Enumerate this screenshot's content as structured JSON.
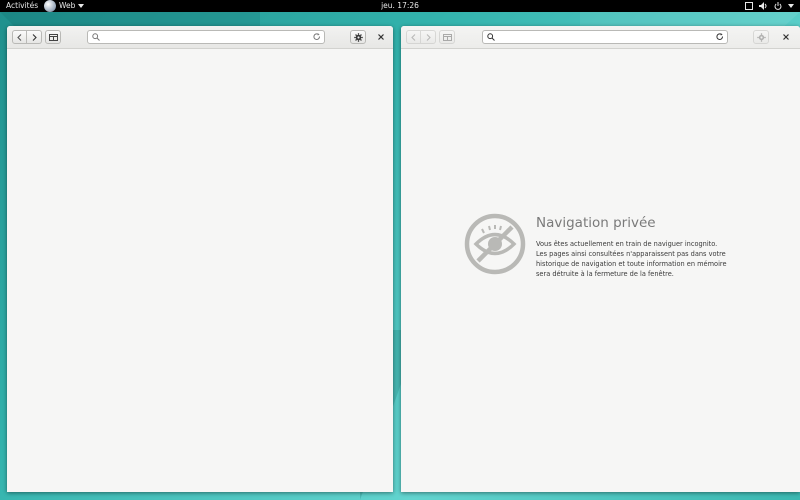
{
  "topbar": {
    "activities": "Activités",
    "app_name": "Web",
    "clock": "jeu. 17:26"
  },
  "icons": {
    "back": "chevron-left-icon",
    "forward": "chevron-right-icon",
    "bookmarks": "bookmarks-icon",
    "search": "search-icon",
    "reload": "reload-icon",
    "settings": "gear-icon",
    "close": "close-icon",
    "private": "eye-crossed-icon",
    "workspace": "window-icon",
    "volume": "volume-icon",
    "power": "power-icon"
  },
  "left_window": {
    "url_value": "",
    "url_placeholder": ""
  },
  "right_window": {
    "url_value": "",
    "url_placeholder": "",
    "private_title": "Navigation privée",
    "private_body": "Vous êtes actuellement en train de naviguer incognito. Les pages ainsi consultées n'apparaissent pas dans votre historique de navigation et toute information en mémoire sera détruite à la fermeture de la fenêtre."
  },
  "colors": {
    "accent_bg": "#33b3ad",
    "topbar": "#000000",
    "private_icon": "#b9b9b6"
  }
}
